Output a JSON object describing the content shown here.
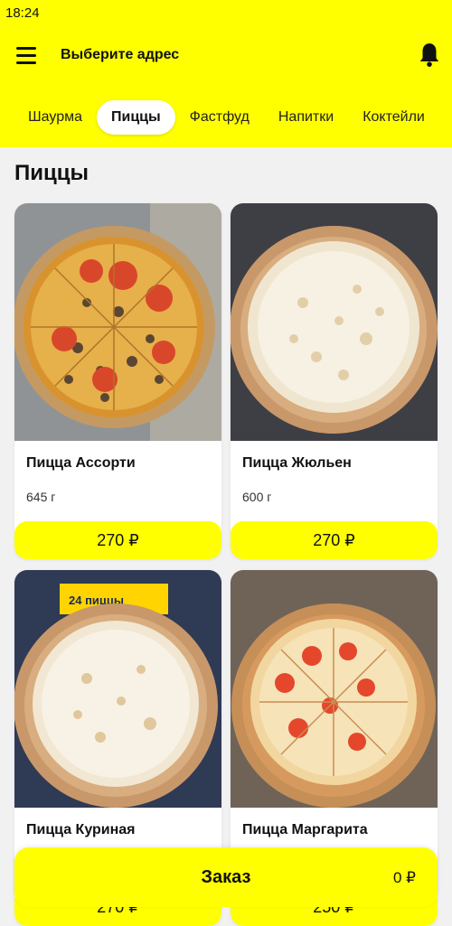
{
  "status_bar": {
    "time": "18:24"
  },
  "header": {
    "address_label": "Выберите адрес"
  },
  "tabs": [
    {
      "label": "Шаурма",
      "active": false
    },
    {
      "label": "Пиццы",
      "active": true
    },
    {
      "label": "Фастфуд",
      "active": false
    },
    {
      "label": "Напитки",
      "active": false
    },
    {
      "label": "Коктейли",
      "active": false
    }
  ],
  "section": {
    "title": "Пиццы"
  },
  "products": [
    {
      "name": "Пицца Ассорти",
      "weight": "645 г",
      "price": "270 ₽"
    },
    {
      "name": "Пицца Жюльен",
      "weight": "600 г",
      "price": "270 ₽"
    },
    {
      "name": "Пицца Куриная",
      "weight": "",
      "price": "270 ₽"
    },
    {
      "name": "Пицца Маргарита",
      "weight": "",
      "price": "250 ₽"
    }
  ],
  "product_images": [
    {
      "label": ""
    },
    {
      "label": ""
    },
    {
      "label": "24 пиццы"
    },
    {
      "label": ""
    }
  ],
  "order": {
    "label": "Заказ",
    "total": "0 ₽"
  },
  "colors": {
    "accent": "#ffff00",
    "background": "#f1f1f1",
    "card": "#ffffff"
  },
  "icons": {
    "menu": "hamburger-menu-icon",
    "notifications": "bell-icon"
  }
}
